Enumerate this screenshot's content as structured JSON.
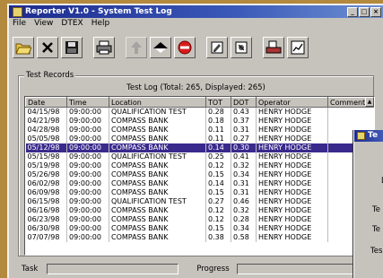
{
  "window": {
    "title": "Reporter V1.0 - System Test Log"
  },
  "menu": [
    {
      "label": "File"
    },
    {
      "label": "View"
    },
    {
      "label": "DTEX"
    },
    {
      "label": "Help"
    }
  ],
  "toolbar": [
    {
      "icon": "open-folder-icon",
      "dim": false
    },
    {
      "icon": "close-x-icon",
      "dim": false
    },
    {
      "icon": "save-disk-icon",
      "dim": false
    },
    {
      "icon": "print-icon",
      "dim": false
    },
    {
      "icon": "move-up-icon",
      "dim": true
    },
    {
      "icon": "eject-icon",
      "dim": false
    },
    {
      "icon": "stop-icon",
      "dim": false
    },
    {
      "icon": "edit-records-icon",
      "dim": false
    },
    {
      "icon": "settings-icon",
      "dim": false
    },
    {
      "icon": "print-preview-icon",
      "dim": false
    },
    {
      "icon": "chart-icon",
      "dim": false
    }
  ],
  "records": {
    "group_label": "Test Records",
    "caption": "Test Log (Total: 265, Displayed: 265)",
    "columns": [
      "Date",
      "Time",
      "Location",
      "TOT",
      "DOT",
      "Operator",
      "Comments"
    ],
    "selected_index": 4,
    "rows": [
      [
        "04/15/98",
        "09:00:00",
        "QUALIFICATION TEST",
        "0.28",
        "0.43",
        "HENRY HODGE",
        ""
      ],
      [
        "04/21/98",
        "09:00:00",
        "COMPASS BANK",
        "0.18",
        "0.37",
        "HENRY HODGE",
        ""
      ],
      [
        "04/28/98",
        "09:00:00",
        "COMPASS BANK",
        "0.11",
        "0.31",
        "HENRY HODGE",
        ""
      ],
      [
        "05/05/98",
        "09:00:00",
        "COMPASS BANK",
        "0.11",
        "0.27",
        "HENRY HODGE",
        ""
      ],
      [
        "05/12/98",
        "09:00:00",
        "COMPASS BANK",
        "0.14",
        "0.30",
        "HENRY HODGE",
        ""
      ],
      [
        "05/15/98",
        "09:00:00",
        "QUALIFICATION TEST",
        "0.25",
        "0.41",
        "HENRY HODGE",
        ""
      ],
      [
        "05/19/98",
        "09:00:00",
        "COMPASS BANK",
        "0.12",
        "0.32",
        "HENRY HODGE",
        ""
      ],
      [
        "05/26/98",
        "09:00:00",
        "COMPASS BANK",
        "0.15",
        "0.34",
        "HENRY HODGE",
        ""
      ],
      [
        "06/02/98",
        "09:00:00",
        "COMPASS BANK",
        "0.14",
        "0.31",
        "HENRY HODGE",
        ""
      ],
      [
        "06/09/98",
        "09:00:00",
        "COMPASS BANK",
        "0.15",
        "0.31",
        "HENRY HODGE",
        ""
      ],
      [
        "06/15/98",
        "09:00:00",
        "QUALIFICATION TEST",
        "0.27",
        "0.46",
        "HENRY HODGE",
        ""
      ],
      [
        "06/16/98",
        "09:00:00",
        "COMPASS BANK",
        "0.12",
        "0.32",
        "HENRY HODGE",
        ""
      ],
      [
        "06/23/98",
        "09:00:00",
        "COMPASS BANK",
        "0.12",
        "0.28",
        "HENRY HODGE",
        ""
      ],
      [
        "06/30/98",
        "09:00:00",
        "COMPASS BANK",
        "0.15",
        "0.34",
        "HENRY HODGE",
        ""
      ],
      [
        "07/07/98",
        "09:00:00",
        "COMPASS BANK",
        "0.38",
        "0.58",
        "HENRY HODGE",
        ""
      ]
    ]
  },
  "status": {
    "task_label": "Task",
    "progress_label": "Progress"
  },
  "dialog": {
    "title": "Te",
    "labels": [
      "T",
      "D",
      "Te",
      "Te",
      "Tes"
    ]
  }
}
